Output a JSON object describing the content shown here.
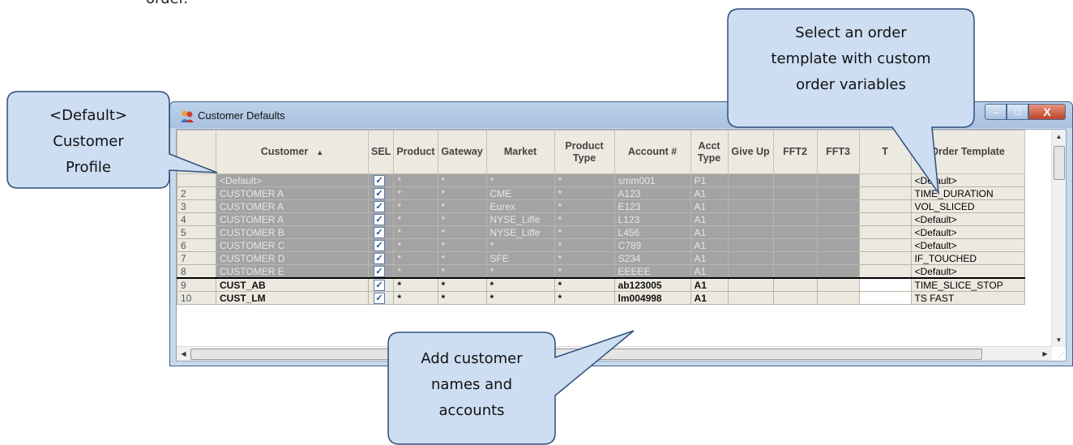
{
  "page_top_text": "order.",
  "window": {
    "title": "Customer Defaults",
    "buttons": {
      "minimize": "–",
      "maximize": "□",
      "close": "X"
    }
  },
  "columns": [
    "",
    "Customer",
    "SEL",
    "Product",
    "Gateway",
    "Market",
    "Product Type",
    "Account #",
    "Acct Type",
    "Give Up",
    "FFT2",
    "FFT3",
    "T",
    "Order Template"
  ],
  "rows": [
    {
      "num": "",
      "customer": "<Default>",
      "sel": true,
      "product": "*",
      "gateway": "*",
      "market": "*",
      "ptype": "*",
      "account": "smm001",
      "atype": "P1",
      "template": "<Default>",
      "style": "gray"
    },
    {
      "num": "2",
      "customer": "CUSTOMER A",
      "sel": true,
      "product": "*",
      "gateway": "*",
      "market": "CME",
      "ptype": "*",
      "account": "A123",
      "atype": "A1",
      "template": "TIME_DURATION",
      "style": "gray"
    },
    {
      "num": "3",
      "customer": "CUSTOMER A",
      "sel": true,
      "product": "*",
      "gateway": "*",
      "market": "Eurex",
      "ptype": "*",
      "account": "E123",
      "atype": "A1",
      "template": "VOL_SLICED",
      "style": "gray"
    },
    {
      "num": "4",
      "customer": "CUSTOMER A",
      "sel": true,
      "product": "*",
      "gateway": "*",
      "market": "NYSE_Liffe",
      "ptype": "*",
      "account": "L123",
      "atype": "A1",
      "template": "<Default>",
      "style": "gray"
    },
    {
      "num": "5",
      "customer": "CUSTOMER B",
      "sel": true,
      "product": "*",
      "gateway": "*",
      "market": "NYSE_Liffe",
      "ptype": "*",
      "account": "L456",
      "atype": "A1",
      "template": "<Default>",
      "style": "gray"
    },
    {
      "num": "6",
      "customer": "CUSTOMER C",
      "sel": true,
      "product": "*",
      "gateway": "*",
      "market": "*",
      "ptype": "*",
      "account": "C789",
      "atype": "A1",
      "template": "<Default>",
      "style": "gray"
    },
    {
      "num": "7",
      "customer": "CUSTOMER D",
      "sel": true,
      "product": "*",
      "gateway": "*",
      "market": "SFE",
      "ptype": "*",
      "account": "S234",
      "atype": "A1",
      "template": "IF_TOUCHED",
      "style": "gray"
    },
    {
      "num": "8",
      "customer": "CUSTOMER E",
      "sel": true,
      "product": "*",
      "gateway": "*",
      "market": "*",
      "ptype": "*",
      "account": "EEEEE",
      "atype": "A1",
      "template": "<Default>",
      "style": "gray"
    },
    {
      "num": "9",
      "customer": "CUST_AB",
      "sel": true,
      "product": "*",
      "gateway": "*",
      "market": "*",
      "ptype": "*",
      "account": "ab123005",
      "atype": "A1",
      "template": "TIME_SLICE_STOP",
      "style": "white"
    },
    {
      "num": "10",
      "customer": "CUST_LM",
      "sel": true,
      "product": "*",
      "gateway": "*",
      "market": "*",
      "ptype": "*",
      "account": "lm004998",
      "atype": "A1",
      "template": "TS FAST",
      "style": "white"
    }
  ],
  "callouts": {
    "default_profile": [
      "<Default>",
      "Customer",
      "Profile"
    ],
    "order_template": [
      "Select an order",
      "template with custom",
      "order variables"
    ],
    "add_customer": [
      "Add customer",
      "names and",
      "accounts"
    ]
  },
  "icons": {
    "app": "customer-profile-icon",
    "check": "checkmark-icon"
  },
  "colors": {
    "gray_row": "#a3a3a3",
    "header": "#ece9e0",
    "callout_fill": "#cdddf2",
    "callout_stroke": "#2e4e7a"
  }
}
